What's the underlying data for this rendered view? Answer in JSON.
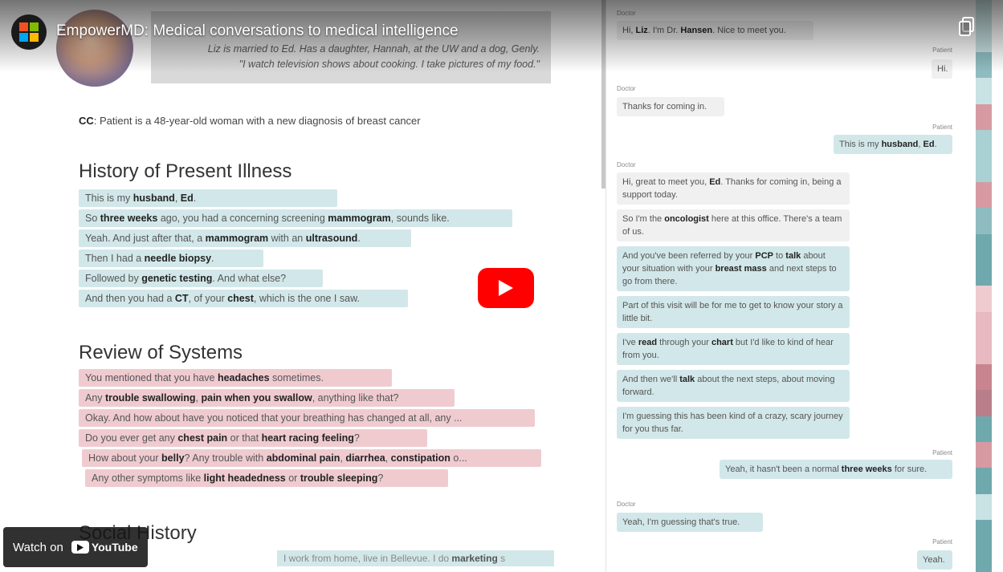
{
  "video": {
    "title": "EmpowerMD: Medical conversations to medical intelligence",
    "watch_label": "Watch on",
    "youtube_label": "YouTube"
  },
  "profile": {
    "bio_line1": "Liz is married to Ed. Has a daughter, Hannah, at the UW and a dog, Genly.",
    "bio_line2": "\"I watch television shows about cooking. I take pictures of my food.\""
  },
  "cc": {
    "label": "CC",
    "text": ": Patient is a 48-year-old woman with a new diagnosis of breast cancer"
  },
  "hpi": {
    "title": "History of Present Illness",
    "lines": [
      [
        {
          "t": "This is my "
        },
        {
          "t": "husband",
          "b": true
        },
        {
          "t": ", "
        },
        {
          "t": "Ed",
          "b": true
        },
        {
          "t": "."
        }
      ],
      [
        {
          "t": "So "
        },
        {
          "t": "three weeks",
          "b": true
        },
        {
          "t": " ago, you had a concerning screening "
        },
        {
          "t": "mammogram",
          "b": true
        },
        {
          "t": ", sounds like."
        }
      ],
      [
        {
          "t": "Yeah. And just after that, a "
        },
        {
          "t": "mammogram",
          "b": true
        },
        {
          "t": " with an "
        },
        {
          "t": "ultrasound",
          "b": true
        },
        {
          "t": "."
        }
      ],
      [
        {
          "t": "Then I had a "
        },
        {
          "t": "needle biopsy",
          "b": true
        },
        {
          "t": "."
        }
      ],
      [
        {
          "t": "Followed by "
        },
        {
          "t": "genetic testing",
          "b": true
        },
        {
          "t": ". And what else?"
        }
      ],
      [
        {
          "t": "And then you had a "
        },
        {
          "t": "CT",
          "b": true
        },
        {
          "t": ", of your "
        },
        {
          "t": "chest",
          "b": true
        },
        {
          "t": ", which is the one I saw."
        }
      ]
    ]
  },
  "ros": {
    "title": "Review of Systems",
    "lines": [
      [
        {
          "t": "You mentioned that you have "
        },
        {
          "t": "headaches",
          "b": true
        },
        {
          "t": " sometimes."
        }
      ],
      [
        {
          "t": "Any "
        },
        {
          "t": "trouble swallowing",
          "b": true
        },
        {
          "t": ", "
        },
        {
          "t": "pain when you swallow",
          "b": true
        },
        {
          "t": ", anything like that?"
        }
      ],
      [
        {
          "t": "Okay. And how about have you noticed that your breathing has changed at all, any ..."
        }
      ],
      [
        {
          "t": "Do you ever get any "
        },
        {
          "t": "chest pain",
          "b": true
        },
        {
          "t": " or that "
        },
        {
          "t": "heart racing feeling",
          "b": true
        },
        {
          "t": "?"
        }
      ],
      [
        {
          "t": "How about your "
        },
        {
          "t": "belly",
          "b": true
        },
        {
          "t": "? Any trouble with "
        },
        {
          "t": "abdominal pain",
          "b": true
        },
        {
          "t": ", "
        },
        {
          "t": "diarrhea",
          "b": true
        },
        {
          "t": ", "
        },
        {
          "t": "constipation",
          "b": true
        },
        {
          "t": " o..."
        }
      ],
      [
        {
          "t": "Any other symptoms like "
        },
        {
          "t": "light headedness",
          "b": true
        },
        {
          "t": " or "
        },
        {
          "t": "trouble sleeping",
          "b": true
        },
        {
          "t": "?"
        }
      ]
    ]
  },
  "social": {
    "title": "Social History",
    "line": [
      {
        "t": "I work from home, live in Bellevue. I do "
      },
      {
        "t": "marketing",
        "b": true
      },
      {
        "t": " s"
      }
    ]
  },
  "chat": {
    "doctor_label": "Doctor",
    "patient_label": "Patient",
    "messages": [
      [
        {
          "t": "Hi, "
        },
        {
          "t": "Liz",
          "b": true
        },
        {
          "t": ". I'm Dr. "
        },
        {
          "t": "Hansen",
          "b": true
        },
        {
          "t": ". Nice to meet you."
        }
      ],
      [
        {
          "t": "Hi."
        }
      ],
      [
        {
          "t": "Thanks for coming in."
        }
      ],
      [
        {
          "t": "This is my "
        },
        {
          "t": "husband",
          "b": true
        },
        {
          "t": ", "
        },
        {
          "t": "Ed",
          "b": true
        },
        {
          "t": "."
        }
      ],
      [
        {
          "t": "Hi, great to meet you, "
        },
        {
          "t": "Ed",
          "b": true
        },
        {
          "t": ". Thanks for coming in, being a support today."
        }
      ],
      [
        {
          "t": "So I'm the "
        },
        {
          "t": "oncologist",
          "b": true
        },
        {
          "t": " here at this office. There's a team of us."
        }
      ],
      [
        {
          "t": "And you've been referred by your "
        },
        {
          "t": "PCP",
          "b": true
        },
        {
          "t": " to "
        },
        {
          "t": "talk",
          "b": true
        },
        {
          "t": " about your situation with your "
        },
        {
          "t": "breast mass",
          "b": true
        },
        {
          "t": " and next steps to go from there."
        }
      ],
      [
        {
          "t": "Part of this visit will be for me to get to know your story a little bit."
        }
      ],
      [
        {
          "t": "I've "
        },
        {
          "t": "read",
          "b": true
        },
        {
          "t": " through your "
        },
        {
          "t": "chart",
          "b": true
        },
        {
          "t": " but I'd like to kind of hear from you."
        }
      ],
      [
        {
          "t": "And then we'll "
        },
        {
          "t": "talk",
          "b": true
        },
        {
          "t": " about the next steps, about moving forward."
        }
      ],
      [
        {
          "t": "I'm guessing this has been kind of a crazy, scary journey for you thus far."
        }
      ],
      [
        {
          "t": "Yeah, it hasn't been a normal "
        },
        {
          "t": "three weeks",
          "b": true
        },
        {
          "t": " for sure."
        }
      ],
      [
        {
          "t": "Yeah, I'm guessing that's true."
        }
      ],
      [
        {
          "t": "Yeah."
        }
      ]
    ]
  },
  "colors": {
    "teal": "#d2e7e9",
    "pink": "#efcbd0",
    "play": "#ff0000"
  },
  "minimap": [
    "#c9e2e4",
    "#c9e2e4",
    "#8fbcc0",
    "#c9e2e4",
    "#d79aa2",
    "#a9d0d3",
    "#a9d0d3",
    "#d79aa2",
    "#8fbcc0",
    "#6fa9ae",
    "#6fa9ae",
    "#efcbd0",
    "#e7b9c0",
    "#e7b9c0",
    "#c8858f",
    "#b87f8a",
    "#6fa9ae",
    "#d79aa2",
    "#6fa9ae",
    "#c9e2e4",
    "#6fa9ae",
    "#6fa9ae"
  ]
}
